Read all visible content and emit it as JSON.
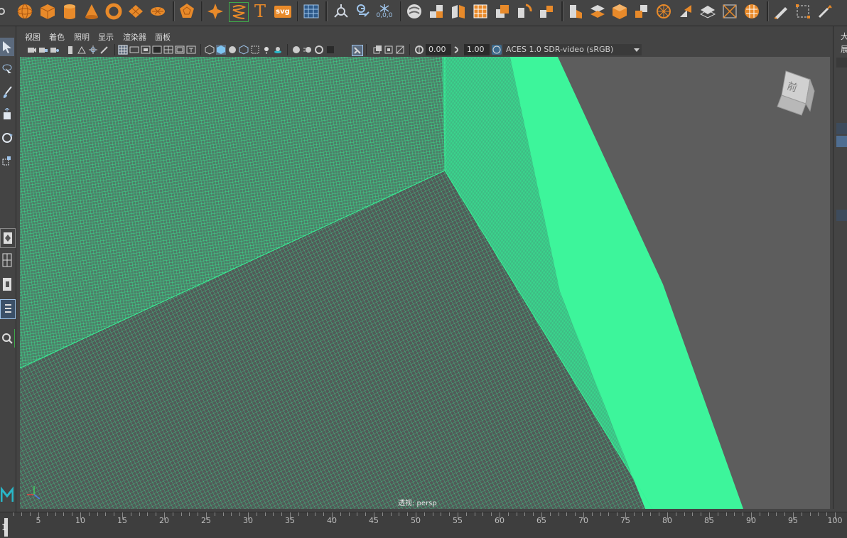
{
  "shelf": {
    "icons": [
      "sphere-icon",
      "cube-icon",
      "cylinder-icon",
      "cone-icon",
      "torus-icon",
      "plane-icon",
      "disc-icon",
      "platonic-icon",
      "star-icon",
      "helix-icon",
      "text-icon",
      "svg-icon",
      "grid-icon",
      "camera-aim-icon",
      "light-icon",
      "particles-icon",
      "combine-icon",
      "separate-icon",
      "extract-icon",
      "smooth-icon",
      "boolean-icon",
      "mirror-icon",
      "bridge-icon",
      "extrude-icon",
      "bevel-icon",
      "fill-hole-icon",
      "append-icon",
      "split-icon",
      "multicut-icon",
      "target-weld-icon",
      "connect-icon",
      "sculpt-icon",
      "stamp-icon",
      "lattice-icon",
      "wrap-icon"
    ],
    "text_icon_label": "T",
    "svg_icon_label": "svg",
    "particle_label": "0,0,0"
  },
  "panel_menu": {
    "items": [
      "视图",
      "着色",
      "照明",
      "显示",
      "渲染器",
      "面板"
    ]
  },
  "panel_toolbar": {
    "exposure_value": "0.00",
    "gamma_value": "1.00",
    "color_space": "ACES 1.0 SDR-video (sRGB)"
  },
  "viewport": {
    "camera_label": "透视: persp",
    "view_cube_face": "前",
    "colors": {
      "wire": "#35f597",
      "background": "#5d5d5d"
    }
  },
  "right_panel": {
    "label_top": "大",
    "label_second": "展"
  },
  "timeline": {
    "ticks": [
      "5",
      "10",
      "15",
      "20",
      "25",
      "30",
      "35",
      "40",
      "45",
      "50",
      "55",
      "60",
      "65",
      "70",
      "75",
      "80",
      "85",
      "90",
      "95",
      "100"
    ],
    "start_label": "1"
  }
}
